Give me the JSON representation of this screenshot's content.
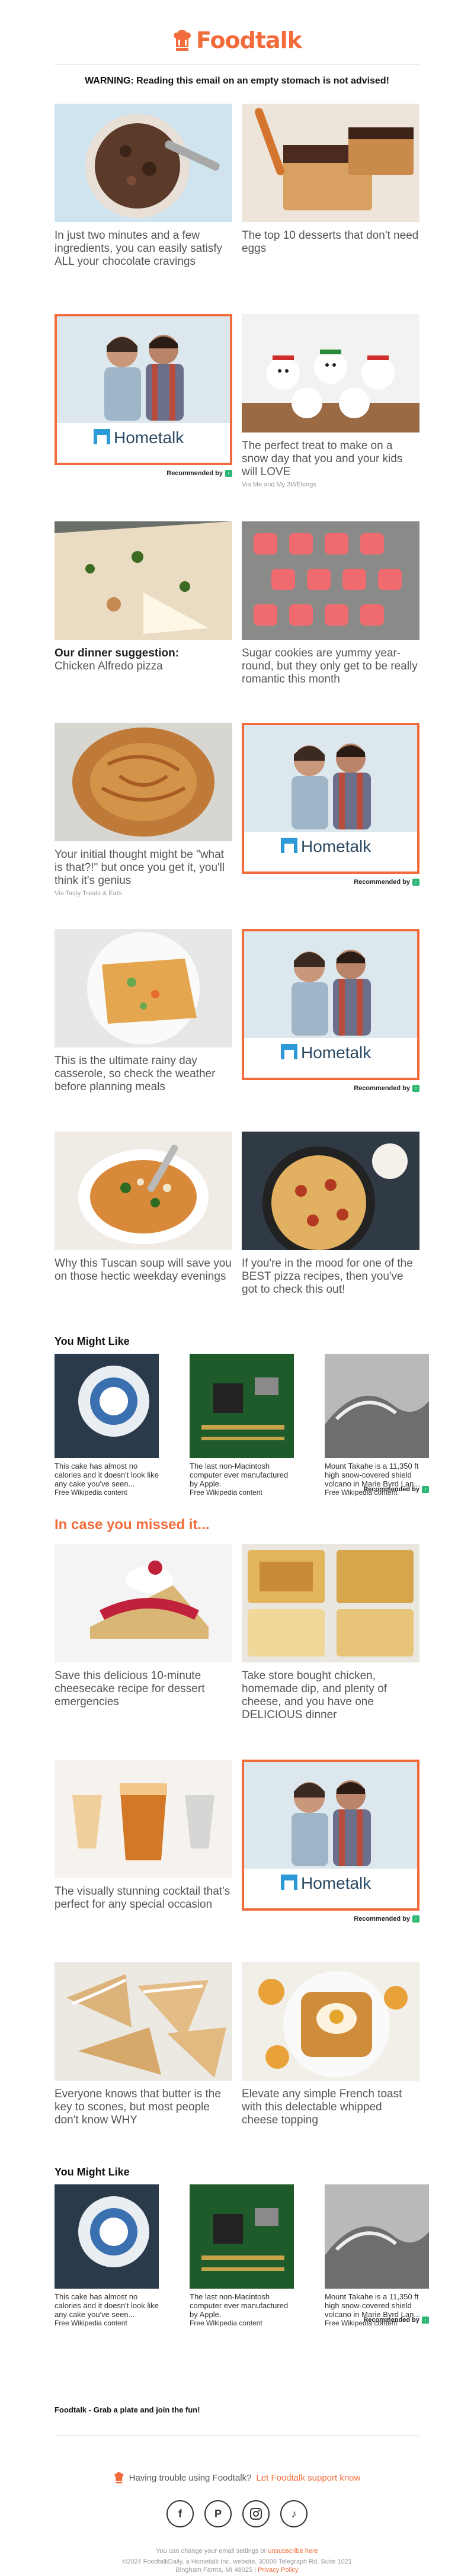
{
  "brand": {
    "name": "Foodtalk",
    "color": "#f26b3a",
    "logo_icon": "chef-hat-icon"
  },
  "warning": "WARNING: Reading this email on an empty stomach is not advised!",
  "articles": [
    {
      "caption": "In just two minutes and a few ingredients, you can easily satisfy ALL your chocolate cravings",
      "via": ""
    },
    {
      "caption": "The top 10 desserts that don't need eggs",
      "via": ""
    },
    {
      "caption": "The perfect treat to make on a snow day that you and your kids will LOVE",
      "via": "Via Me and My 3WEkings"
    },
    {
      "caption_bold": "Our dinner suggestion:",
      "caption": "Chicken Alfredo pizza",
      "via": ""
    },
    {
      "caption": "Sugar cookies are yummy year-round, but they only get to be really romantic this month",
      "via": ""
    },
    {
      "caption": "Your initial thought might be \"what is that?!\" but once you get it, you'll think it's genius",
      "via": "Via Tasty Treats & Eats"
    },
    {
      "caption": "This is the ultimate rainy day casserole, so check the weather before planning meals",
      "via": ""
    },
    {
      "caption": "Why this Tuscan soup will save you on those hectic weekday evenings",
      "via": ""
    },
    {
      "caption": "If you're in the mood for one of the BEST pizza recipes, then you've got to check this out!",
      "via": ""
    },
    {
      "caption": "Save this delicious 10-minute cheesecake recipe for dessert emergencies",
      "via": ""
    },
    {
      "caption": "Take store bought chicken, homemade dip, and plenty of cheese, and you have one DELICIOUS dinner",
      "via": ""
    },
    {
      "caption": "The visually stunning cocktail that's perfect for any special occasion",
      "via": ""
    },
    {
      "caption": "Everyone knows that butter is the key to scones, but most people don't know WHY",
      "via": ""
    },
    {
      "caption": "Elevate any simple French toast with this delectable whipped cheese topping",
      "via": ""
    }
  ],
  "ad": {
    "brand": "Hometalk",
    "recommended": "Recommended by"
  },
  "you_might_like": {
    "title": "You Might Like",
    "items": [
      {
        "caption": "This cake has almost no calories and it doesn't look like any cake you've seen...",
        "source": "Free Wikipedia content"
      },
      {
        "caption": "The last non-Macintosh computer ever manufactured by Apple.",
        "source": "Free Wikipedia content"
      },
      {
        "caption": "Mount Takahe is a 11,350 ft high snow-covered shield volcano in Marie Byrd Lan...",
        "source": "Free Wikipedia content"
      }
    ]
  },
  "missed_title": "In case you missed it...",
  "footer": {
    "tagline": "Foodtalk - Grab a plate and join the fun!",
    "trouble_text": "Having trouble using Foodtalk?",
    "trouble_link": "Let Foodtalk support know",
    "socials": [
      "facebook-icon",
      "pinterest-icon",
      "instagram-icon",
      "tiktok-icon"
    ],
    "settings_text": "You can change your email settings or",
    "unsubscribe": "unsubscribe here",
    "copyright": "©2024 FoodtalkDaily, a Hometalk Inc. website. 30000 Telegraph Rd, Suite 1021",
    "address2": "Bingham Farms, MI 48025",
    "privacy": "Privacy Policy"
  }
}
